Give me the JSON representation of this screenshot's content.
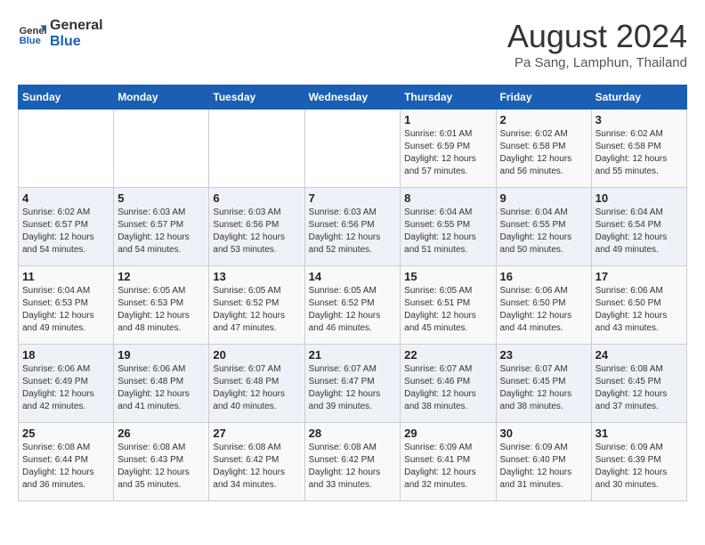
{
  "header": {
    "logo_line1": "General",
    "logo_line2": "Blue",
    "month_year": "August 2024",
    "location": "Pa Sang, Lamphun, Thailand"
  },
  "days_of_week": [
    "Sunday",
    "Monday",
    "Tuesday",
    "Wednesday",
    "Thursday",
    "Friday",
    "Saturday"
  ],
  "weeks": [
    [
      {
        "day": "",
        "info": ""
      },
      {
        "day": "",
        "info": ""
      },
      {
        "day": "",
        "info": ""
      },
      {
        "day": "",
        "info": ""
      },
      {
        "day": "1",
        "info": "Sunrise: 6:01 AM\nSunset: 6:59 PM\nDaylight: 12 hours\nand 57 minutes."
      },
      {
        "day": "2",
        "info": "Sunrise: 6:02 AM\nSunset: 6:58 PM\nDaylight: 12 hours\nand 56 minutes."
      },
      {
        "day": "3",
        "info": "Sunrise: 6:02 AM\nSunset: 6:58 PM\nDaylight: 12 hours\nand 55 minutes."
      }
    ],
    [
      {
        "day": "4",
        "info": "Sunrise: 6:02 AM\nSunset: 6:57 PM\nDaylight: 12 hours\nand 54 minutes."
      },
      {
        "day": "5",
        "info": "Sunrise: 6:03 AM\nSunset: 6:57 PM\nDaylight: 12 hours\nand 54 minutes."
      },
      {
        "day": "6",
        "info": "Sunrise: 6:03 AM\nSunset: 6:56 PM\nDaylight: 12 hours\nand 53 minutes."
      },
      {
        "day": "7",
        "info": "Sunrise: 6:03 AM\nSunset: 6:56 PM\nDaylight: 12 hours\nand 52 minutes."
      },
      {
        "day": "8",
        "info": "Sunrise: 6:04 AM\nSunset: 6:55 PM\nDaylight: 12 hours\nand 51 minutes."
      },
      {
        "day": "9",
        "info": "Sunrise: 6:04 AM\nSunset: 6:55 PM\nDaylight: 12 hours\nand 50 minutes."
      },
      {
        "day": "10",
        "info": "Sunrise: 6:04 AM\nSunset: 6:54 PM\nDaylight: 12 hours\nand 49 minutes."
      }
    ],
    [
      {
        "day": "11",
        "info": "Sunrise: 6:04 AM\nSunset: 6:53 PM\nDaylight: 12 hours\nand 49 minutes."
      },
      {
        "day": "12",
        "info": "Sunrise: 6:05 AM\nSunset: 6:53 PM\nDaylight: 12 hours\nand 48 minutes."
      },
      {
        "day": "13",
        "info": "Sunrise: 6:05 AM\nSunset: 6:52 PM\nDaylight: 12 hours\nand 47 minutes."
      },
      {
        "day": "14",
        "info": "Sunrise: 6:05 AM\nSunset: 6:52 PM\nDaylight: 12 hours\nand 46 minutes."
      },
      {
        "day": "15",
        "info": "Sunrise: 6:05 AM\nSunset: 6:51 PM\nDaylight: 12 hours\nand 45 minutes."
      },
      {
        "day": "16",
        "info": "Sunrise: 6:06 AM\nSunset: 6:50 PM\nDaylight: 12 hours\nand 44 minutes."
      },
      {
        "day": "17",
        "info": "Sunrise: 6:06 AM\nSunset: 6:50 PM\nDaylight: 12 hours\nand 43 minutes."
      }
    ],
    [
      {
        "day": "18",
        "info": "Sunrise: 6:06 AM\nSunset: 6:49 PM\nDaylight: 12 hours\nand 42 minutes."
      },
      {
        "day": "19",
        "info": "Sunrise: 6:06 AM\nSunset: 6:48 PM\nDaylight: 12 hours\nand 41 minutes."
      },
      {
        "day": "20",
        "info": "Sunrise: 6:07 AM\nSunset: 6:48 PM\nDaylight: 12 hours\nand 40 minutes."
      },
      {
        "day": "21",
        "info": "Sunrise: 6:07 AM\nSunset: 6:47 PM\nDaylight: 12 hours\nand 39 minutes."
      },
      {
        "day": "22",
        "info": "Sunrise: 6:07 AM\nSunset: 6:46 PM\nDaylight: 12 hours\nand 38 minutes."
      },
      {
        "day": "23",
        "info": "Sunrise: 6:07 AM\nSunset: 6:45 PM\nDaylight: 12 hours\nand 38 minutes."
      },
      {
        "day": "24",
        "info": "Sunrise: 6:08 AM\nSunset: 6:45 PM\nDaylight: 12 hours\nand 37 minutes."
      }
    ],
    [
      {
        "day": "25",
        "info": "Sunrise: 6:08 AM\nSunset: 6:44 PM\nDaylight: 12 hours\nand 36 minutes."
      },
      {
        "day": "26",
        "info": "Sunrise: 6:08 AM\nSunset: 6:43 PM\nDaylight: 12 hours\nand 35 minutes."
      },
      {
        "day": "27",
        "info": "Sunrise: 6:08 AM\nSunset: 6:42 PM\nDaylight: 12 hours\nand 34 minutes."
      },
      {
        "day": "28",
        "info": "Sunrise: 6:08 AM\nSunset: 6:42 PM\nDaylight: 12 hours\nand 33 minutes."
      },
      {
        "day": "29",
        "info": "Sunrise: 6:09 AM\nSunset: 6:41 PM\nDaylight: 12 hours\nand 32 minutes."
      },
      {
        "day": "30",
        "info": "Sunrise: 6:09 AM\nSunset: 6:40 PM\nDaylight: 12 hours\nand 31 minutes."
      },
      {
        "day": "31",
        "info": "Sunrise: 6:09 AM\nSunset: 6:39 PM\nDaylight: 12 hours\nand 30 minutes."
      }
    ]
  ]
}
